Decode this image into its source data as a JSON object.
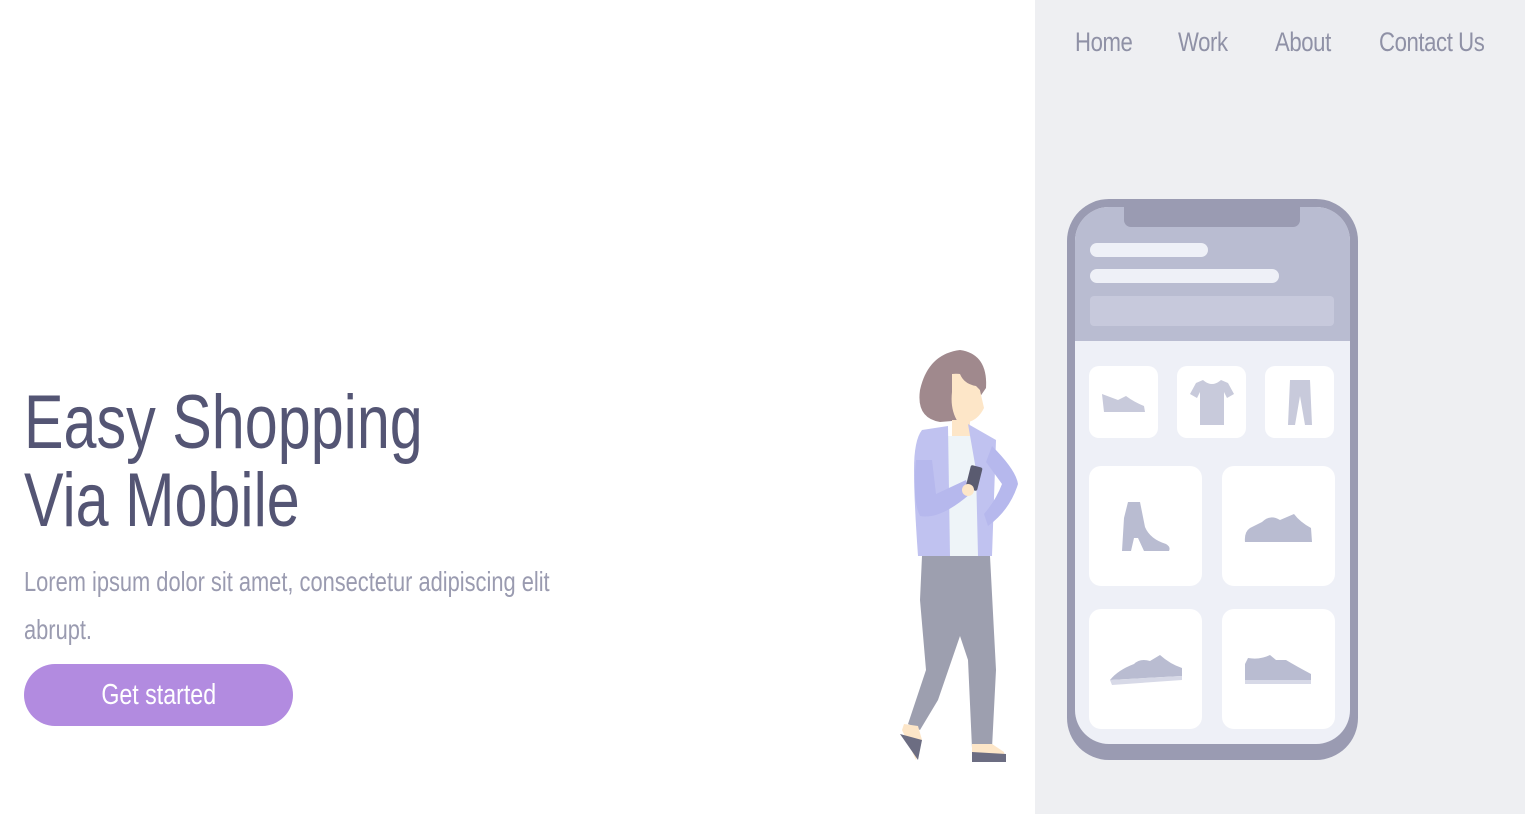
{
  "nav": {
    "items": [
      {
        "label": "Home"
      },
      {
        "label": "Work"
      },
      {
        "label": "About"
      },
      {
        "label": "Contact Us"
      }
    ]
  },
  "hero": {
    "title_line1": "Easy Shopping",
    "title_line2": "Via Mobile",
    "subtitle": "Lorem ipsum dolor sit amet, consectetur adipiscing elit abrupt.",
    "cta_label": "Get started"
  },
  "colors": {
    "accent": "#b28be0",
    "heading": "#545574",
    "muted_text": "#9a9bb0",
    "panel_bg": "#eeeff2"
  }
}
